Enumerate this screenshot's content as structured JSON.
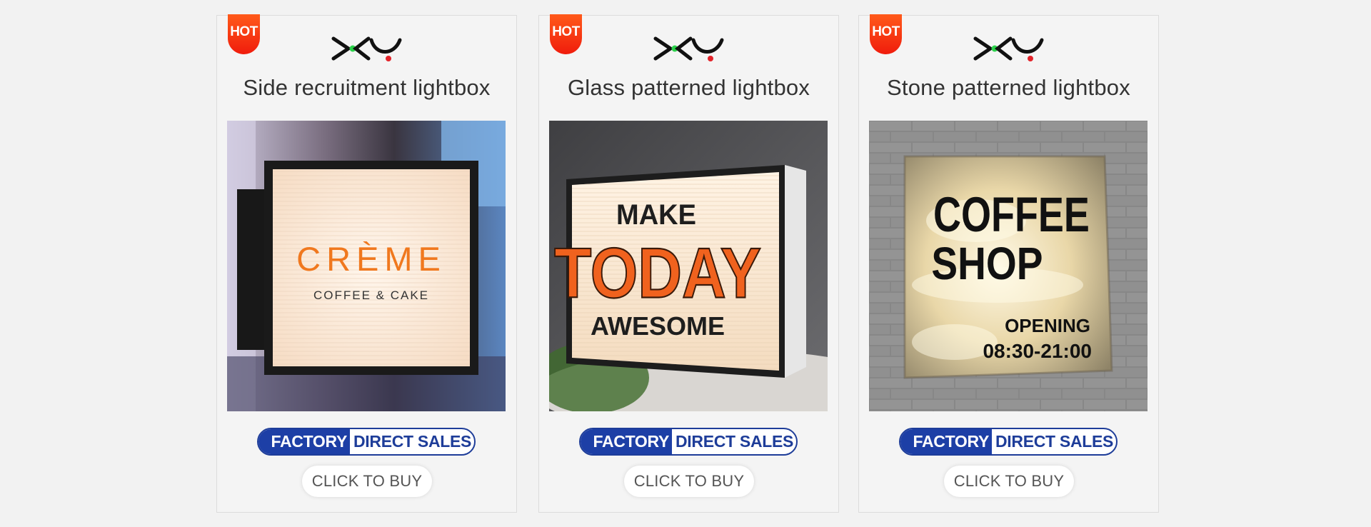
{
  "colors": {
    "hot": "#f01c0c",
    "badge_blue": "#1d3fa6",
    "logo_green": "#2bd24a",
    "logo_red": "#e3232a"
  },
  "products": [
    {
      "hot": "HOT",
      "title": "Side recruitment lightbox",
      "badge": {
        "part1": "FACTORY",
        "part2": "DIRECT SALES"
      },
      "buy": "CLICK TO BUY",
      "sign": {
        "line1": "CRÈME",
        "line2": "COFFEE & CAKE"
      }
    },
    {
      "hot": "HOT",
      "title": "Glass patterned lightbox",
      "badge": {
        "part1": "FACTORY",
        "part2": "DIRECT SALES"
      },
      "buy": "CLICK TO BUY",
      "sign": {
        "line1": "MAKE",
        "line2": "TODAY",
        "line3": "AWESOME"
      }
    },
    {
      "hot": "HOT",
      "title": "Stone patterned lightbox",
      "badge": {
        "part1": "FACTORY",
        "part2": "DIRECT SALES"
      },
      "buy": "CLICK TO BUY",
      "sign": {
        "line1": "COFFEE",
        "line2": "SHOP",
        "line3": "OPENING",
        "line4": "08:30-21:00"
      }
    }
  ]
}
